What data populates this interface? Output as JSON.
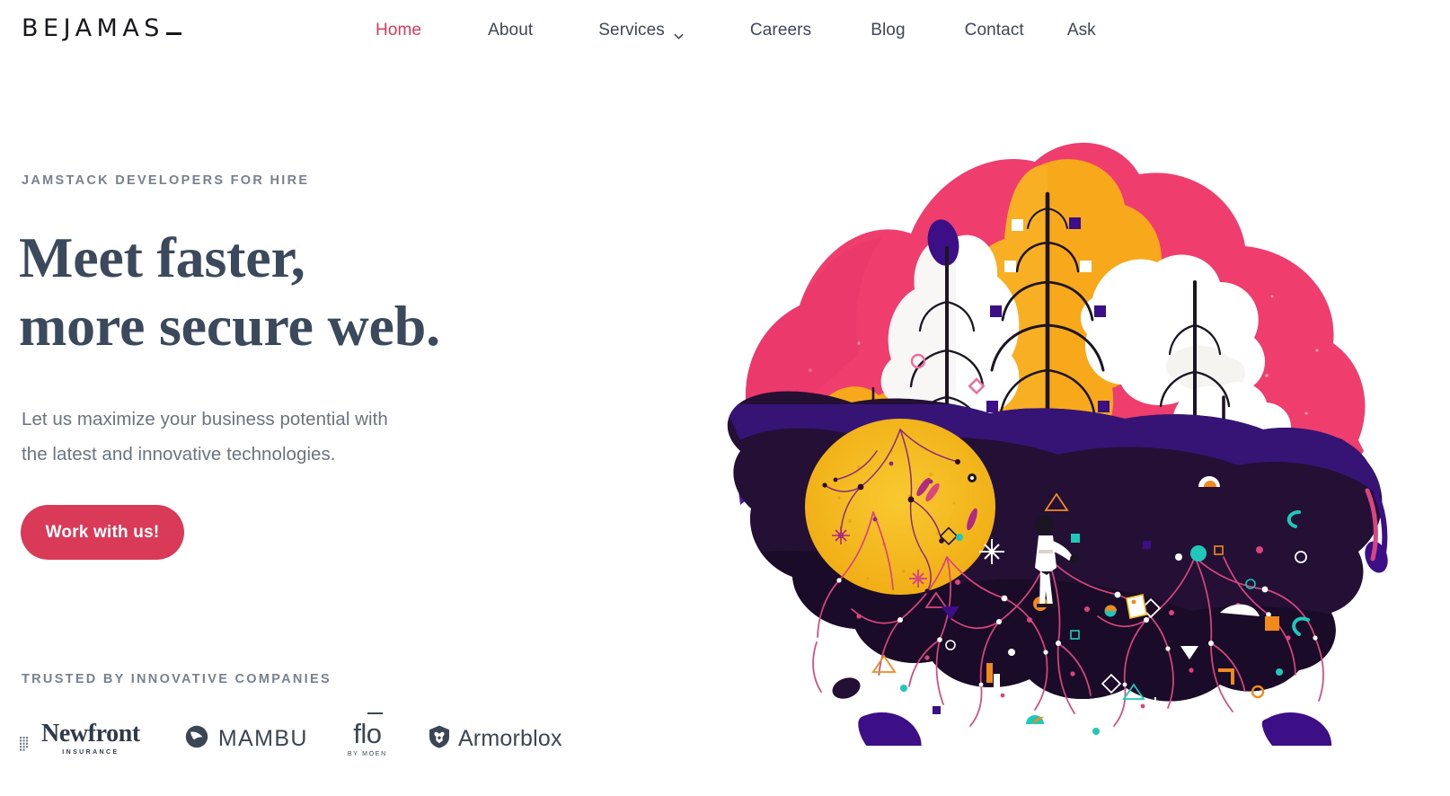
{
  "brand": {
    "logo_text": "BEJAMAS",
    "logo_cursor": "_",
    "accent_color": "#e0375c",
    "button_color": "#d93a57",
    "text_color": "#3d4757",
    "muted_color": "#78818f"
  },
  "nav": {
    "items": [
      {
        "label": "Home",
        "active": true,
        "has_dropdown": false
      },
      {
        "label": "About",
        "active": false,
        "has_dropdown": false
      },
      {
        "label": "Services",
        "active": false,
        "has_dropdown": true,
        "dropdown_icon": "chevron-down-icon"
      },
      {
        "label": "Careers",
        "active": false,
        "has_dropdown": false
      },
      {
        "label": "Blog",
        "active": false,
        "has_dropdown": false
      },
      {
        "label": "Contact",
        "active": false,
        "has_dropdown": false
      },
      {
        "label": "Ask",
        "active": false,
        "has_dropdown": false
      }
    ]
  },
  "hero": {
    "eyebrow": "JAMSTACK DEVELOPERS FOR HIRE",
    "headline_line1": "Meet faster,",
    "headline_line2": "more secure web.",
    "subcopy_line1": "Let us maximize your business potential with",
    "subcopy_line2": "the latest and innovative technologies.",
    "cta_label": "Work with us!"
  },
  "trusted": {
    "label": "TRUSTED BY INNOVATIVE COMPANIES",
    "logos": [
      {
        "name": "Newfront",
        "wordmark": "Newfront",
        "sub": "INSURANCE",
        "icon": "newfront-grid-icon"
      },
      {
        "name": "Mambu",
        "wordmark": "MAMBU",
        "icon": "mambu-circle-icon"
      },
      {
        "name": "Flo by Moen",
        "wordmark_pre": "fl",
        "wordmark_o": "o",
        "sub": "BY MOEN",
        "icon": "flo-macron-icon"
      },
      {
        "name": "Armorblox",
        "wordmark": "Armorblox",
        "icon": "armorblox-shield-icon"
      }
    ]
  },
  "illustration": {
    "name": "floating-island-forest-illustration",
    "palette": {
      "pink_cloud": "#ef3e6d",
      "pink_cloud_deep": "#e8356a",
      "orange": "#f7a81b",
      "orange_deep": "#eb9a10",
      "white": "#ffffff",
      "soil_dark": "#241035",
      "soil_darker": "#1a0b27",
      "purple_band": "#4b1e9e",
      "purple_deep": "#3a1580",
      "root_pink": "#d8467f",
      "trunk": "#1b1422",
      "teal": "#1fc8b8",
      "yellow_sun": "#f5bb1d"
    }
  }
}
